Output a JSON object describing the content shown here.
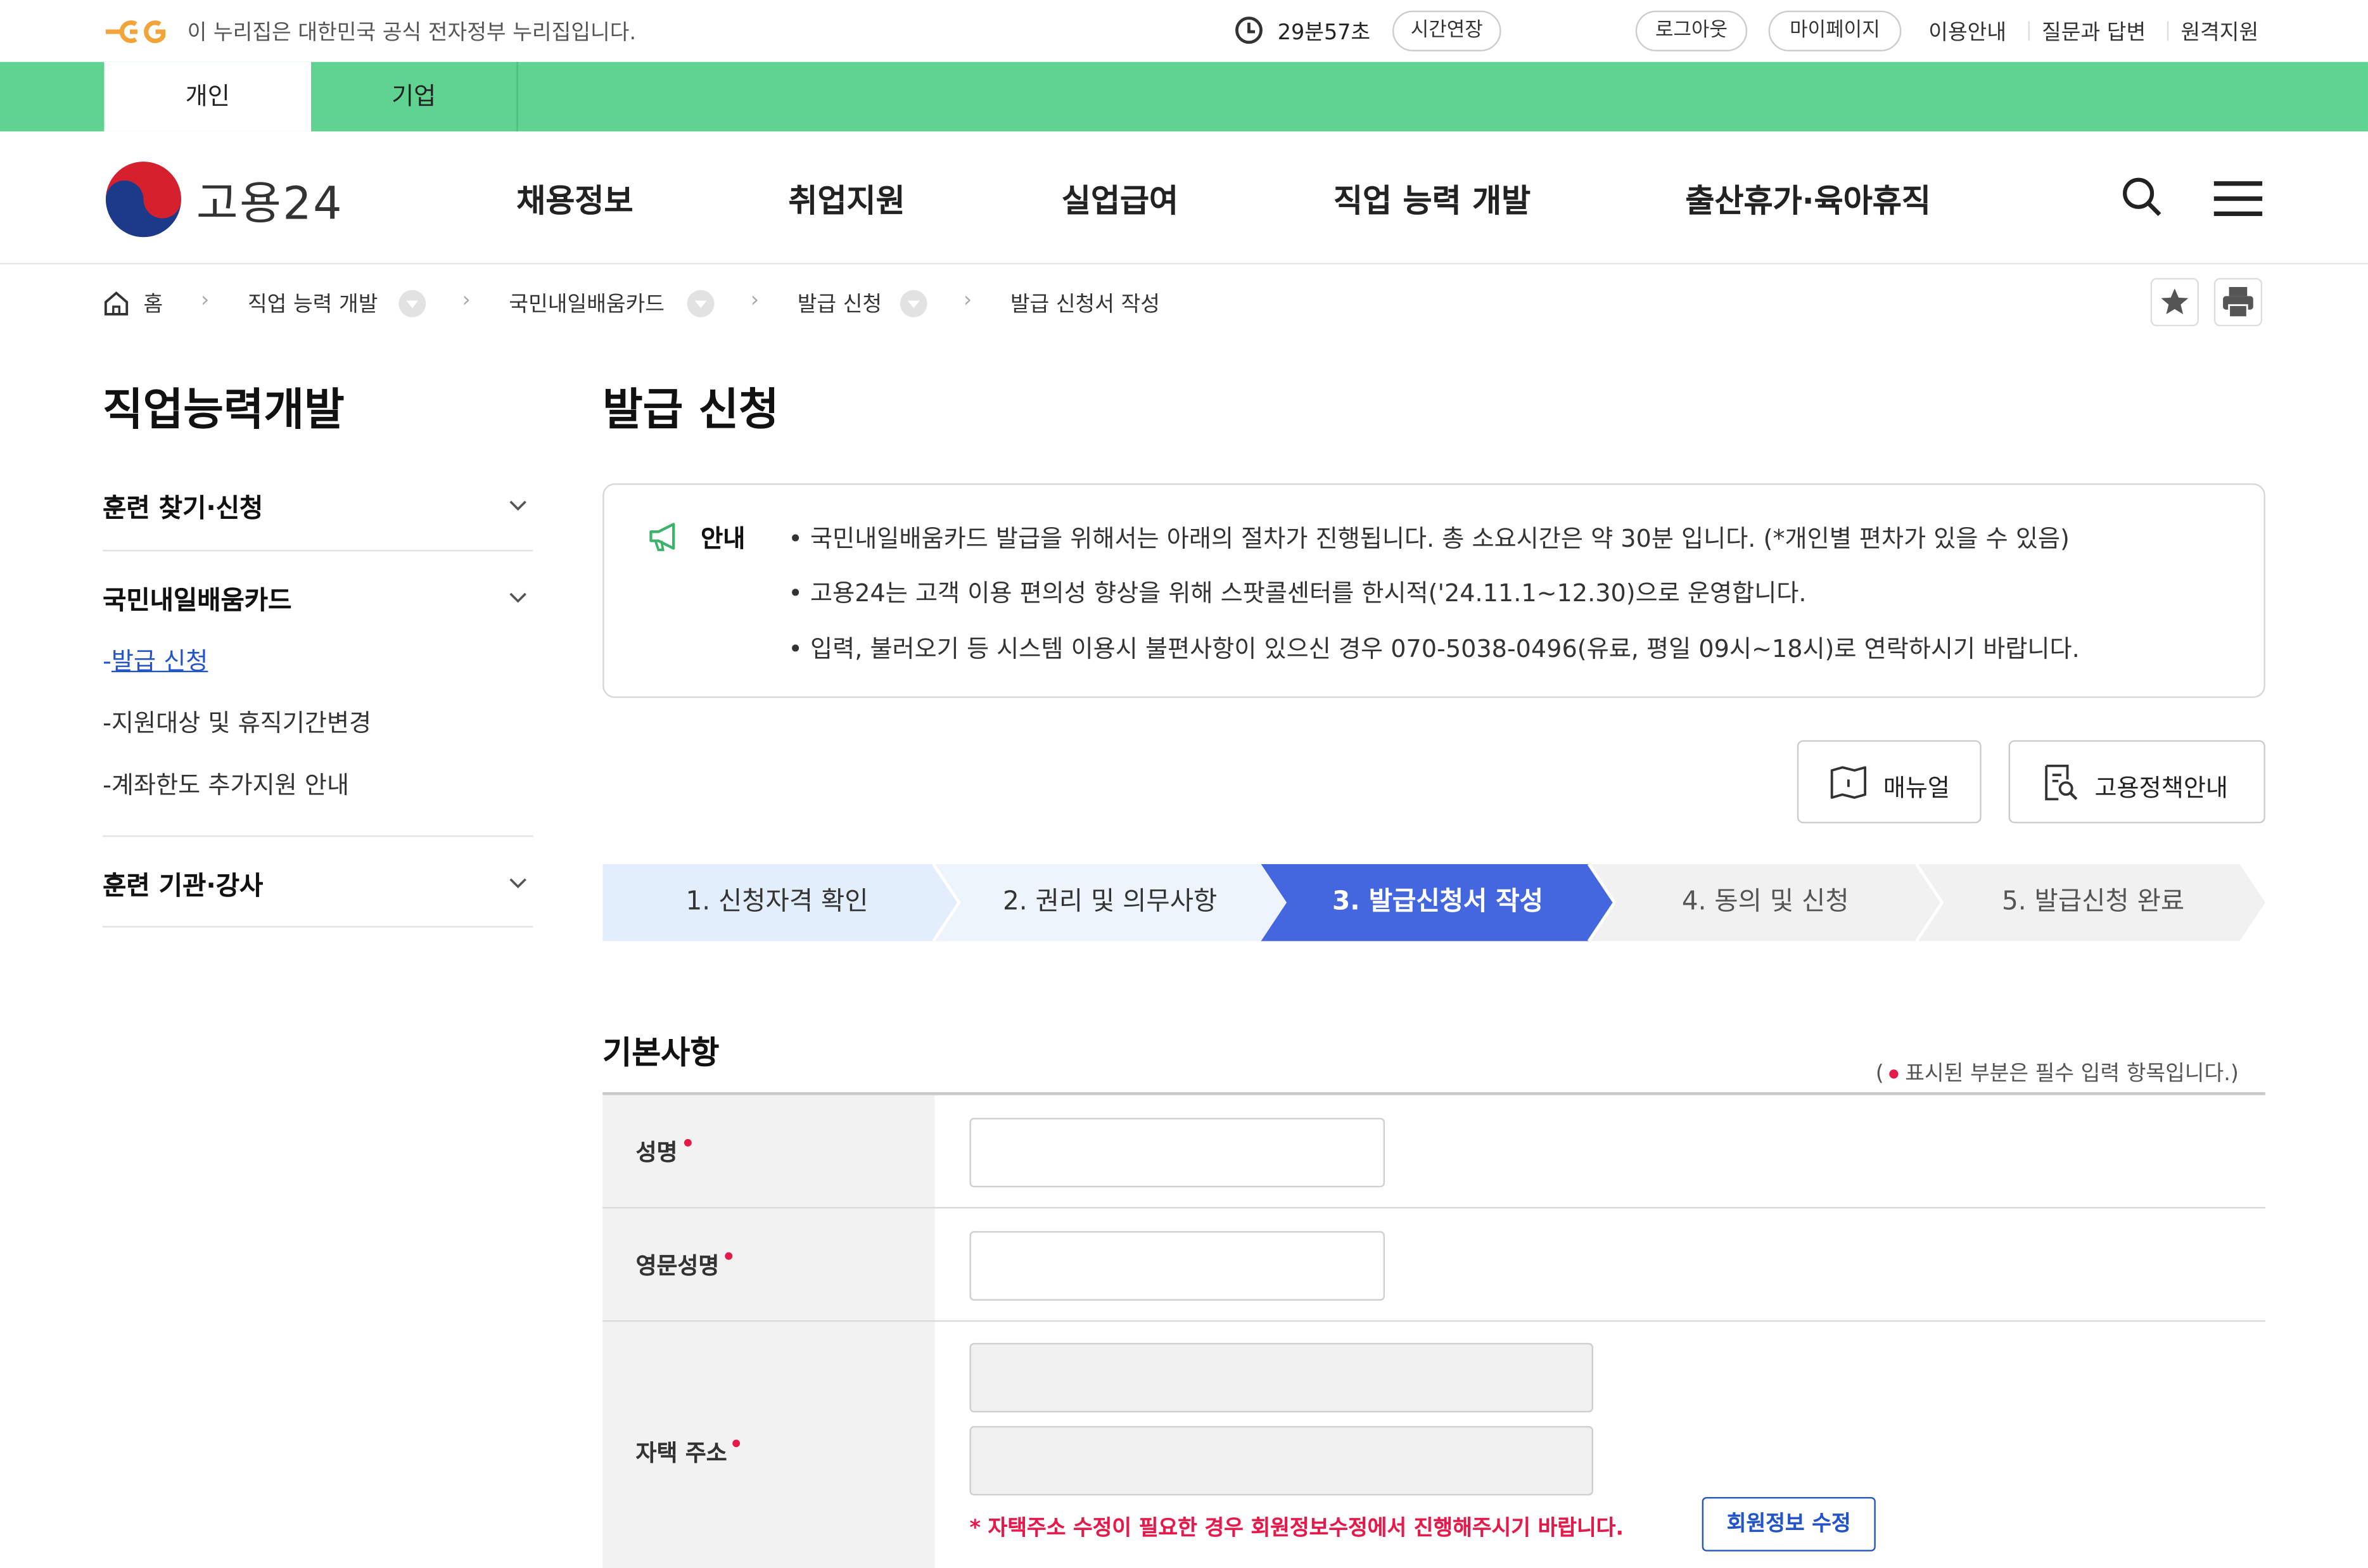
{
  "gov_banner": {
    "text": "이 누리집은 대한민국 공식 전자정부 누리집입니다.",
    "timer": "29분57초",
    "extend_label": "시간연장",
    "logout_label": "로그아웃",
    "mypage_label": "마이페이지",
    "links": [
      "이용안내",
      "질문과 답변",
      "원격지원"
    ]
  },
  "user_tabs": [
    "개인",
    "기업"
  ],
  "brand": {
    "name": "고용24"
  },
  "main_menu": [
    "채용정보",
    "취업지원",
    "실업급여",
    "직업 능력 개발",
    "출산휴가·육아휴직"
  ],
  "breadcrumb": {
    "home": "홈",
    "items": [
      "직업 능력 개발",
      "국민내일배움카드",
      "발급 신청",
      "발급 신청서 작성"
    ]
  },
  "sidebar": {
    "title": "직업능력개발",
    "sections": [
      {
        "label": "훈련 찾기·신청"
      },
      {
        "label": "국민내일배움카드",
        "items": [
          "발급 신청",
          "지원대상 및 휴직기간변경",
          "계좌한도 추가지원 안내"
        ]
      },
      {
        "label": "훈련 기관·강사"
      }
    ]
  },
  "page": {
    "title": "발급 신청"
  },
  "notice": {
    "label": "안내",
    "items": [
      "국민내일배움카드 발급을 위해서는 아래의 절차가 진행됩니다. 총 소요시간은 약 30분 입니다. (*개인별 편차가 있을 수 있음)",
      "고용24는 고객 이용 편의성 향상을 위해 스팟콜센터를 한시적('24.11.1~12.30)으로 운영합니다.",
      "입력, 불러오기 등 시스템 이용시 불편사항이 있으신 경우 070-5038-0496(유료, 평일 09시~18시)로 연락하시기 바랍니다."
    ]
  },
  "buttons": {
    "manual": "매뉴얼",
    "policy": "고용정책안내"
  },
  "steps": {
    "items": [
      "1. 신청자격 확인",
      "2. 권리 및 의무사항",
      "3. 발급신청서 작성",
      "4. 동의 및 신청",
      "5. 발급신청 완료"
    ],
    "current": 3
  },
  "form": {
    "section_title": "기본사항",
    "required_note_pre": "(",
    "required_note": "표시된 부분은 필수 입력 항목입니다.)",
    "fields": {
      "name": {
        "label": "성명",
        "value": ""
      },
      "english_name": {
        "label": "영문성명",
        "value": ""
      },
      "address": {
        "label": "자택 주소",
        "line1": "",
        "line2": ""
      }
    },
    "address_note": "* 자택주소 수정이 필요한 경우 회원정보수정에서 진행해주시기 바랍니다.",
    "edit_member_button": "회원정보 수정"
  },
  "colors": {
    "green_bar": "#61d390",
    "step_done": "#e3eefc",
    "step_current": "#4466de",
    "step_todo": "#f1f1f1",
    "required": "#e6194b",
    "link": "#2454c9"
  }
}
